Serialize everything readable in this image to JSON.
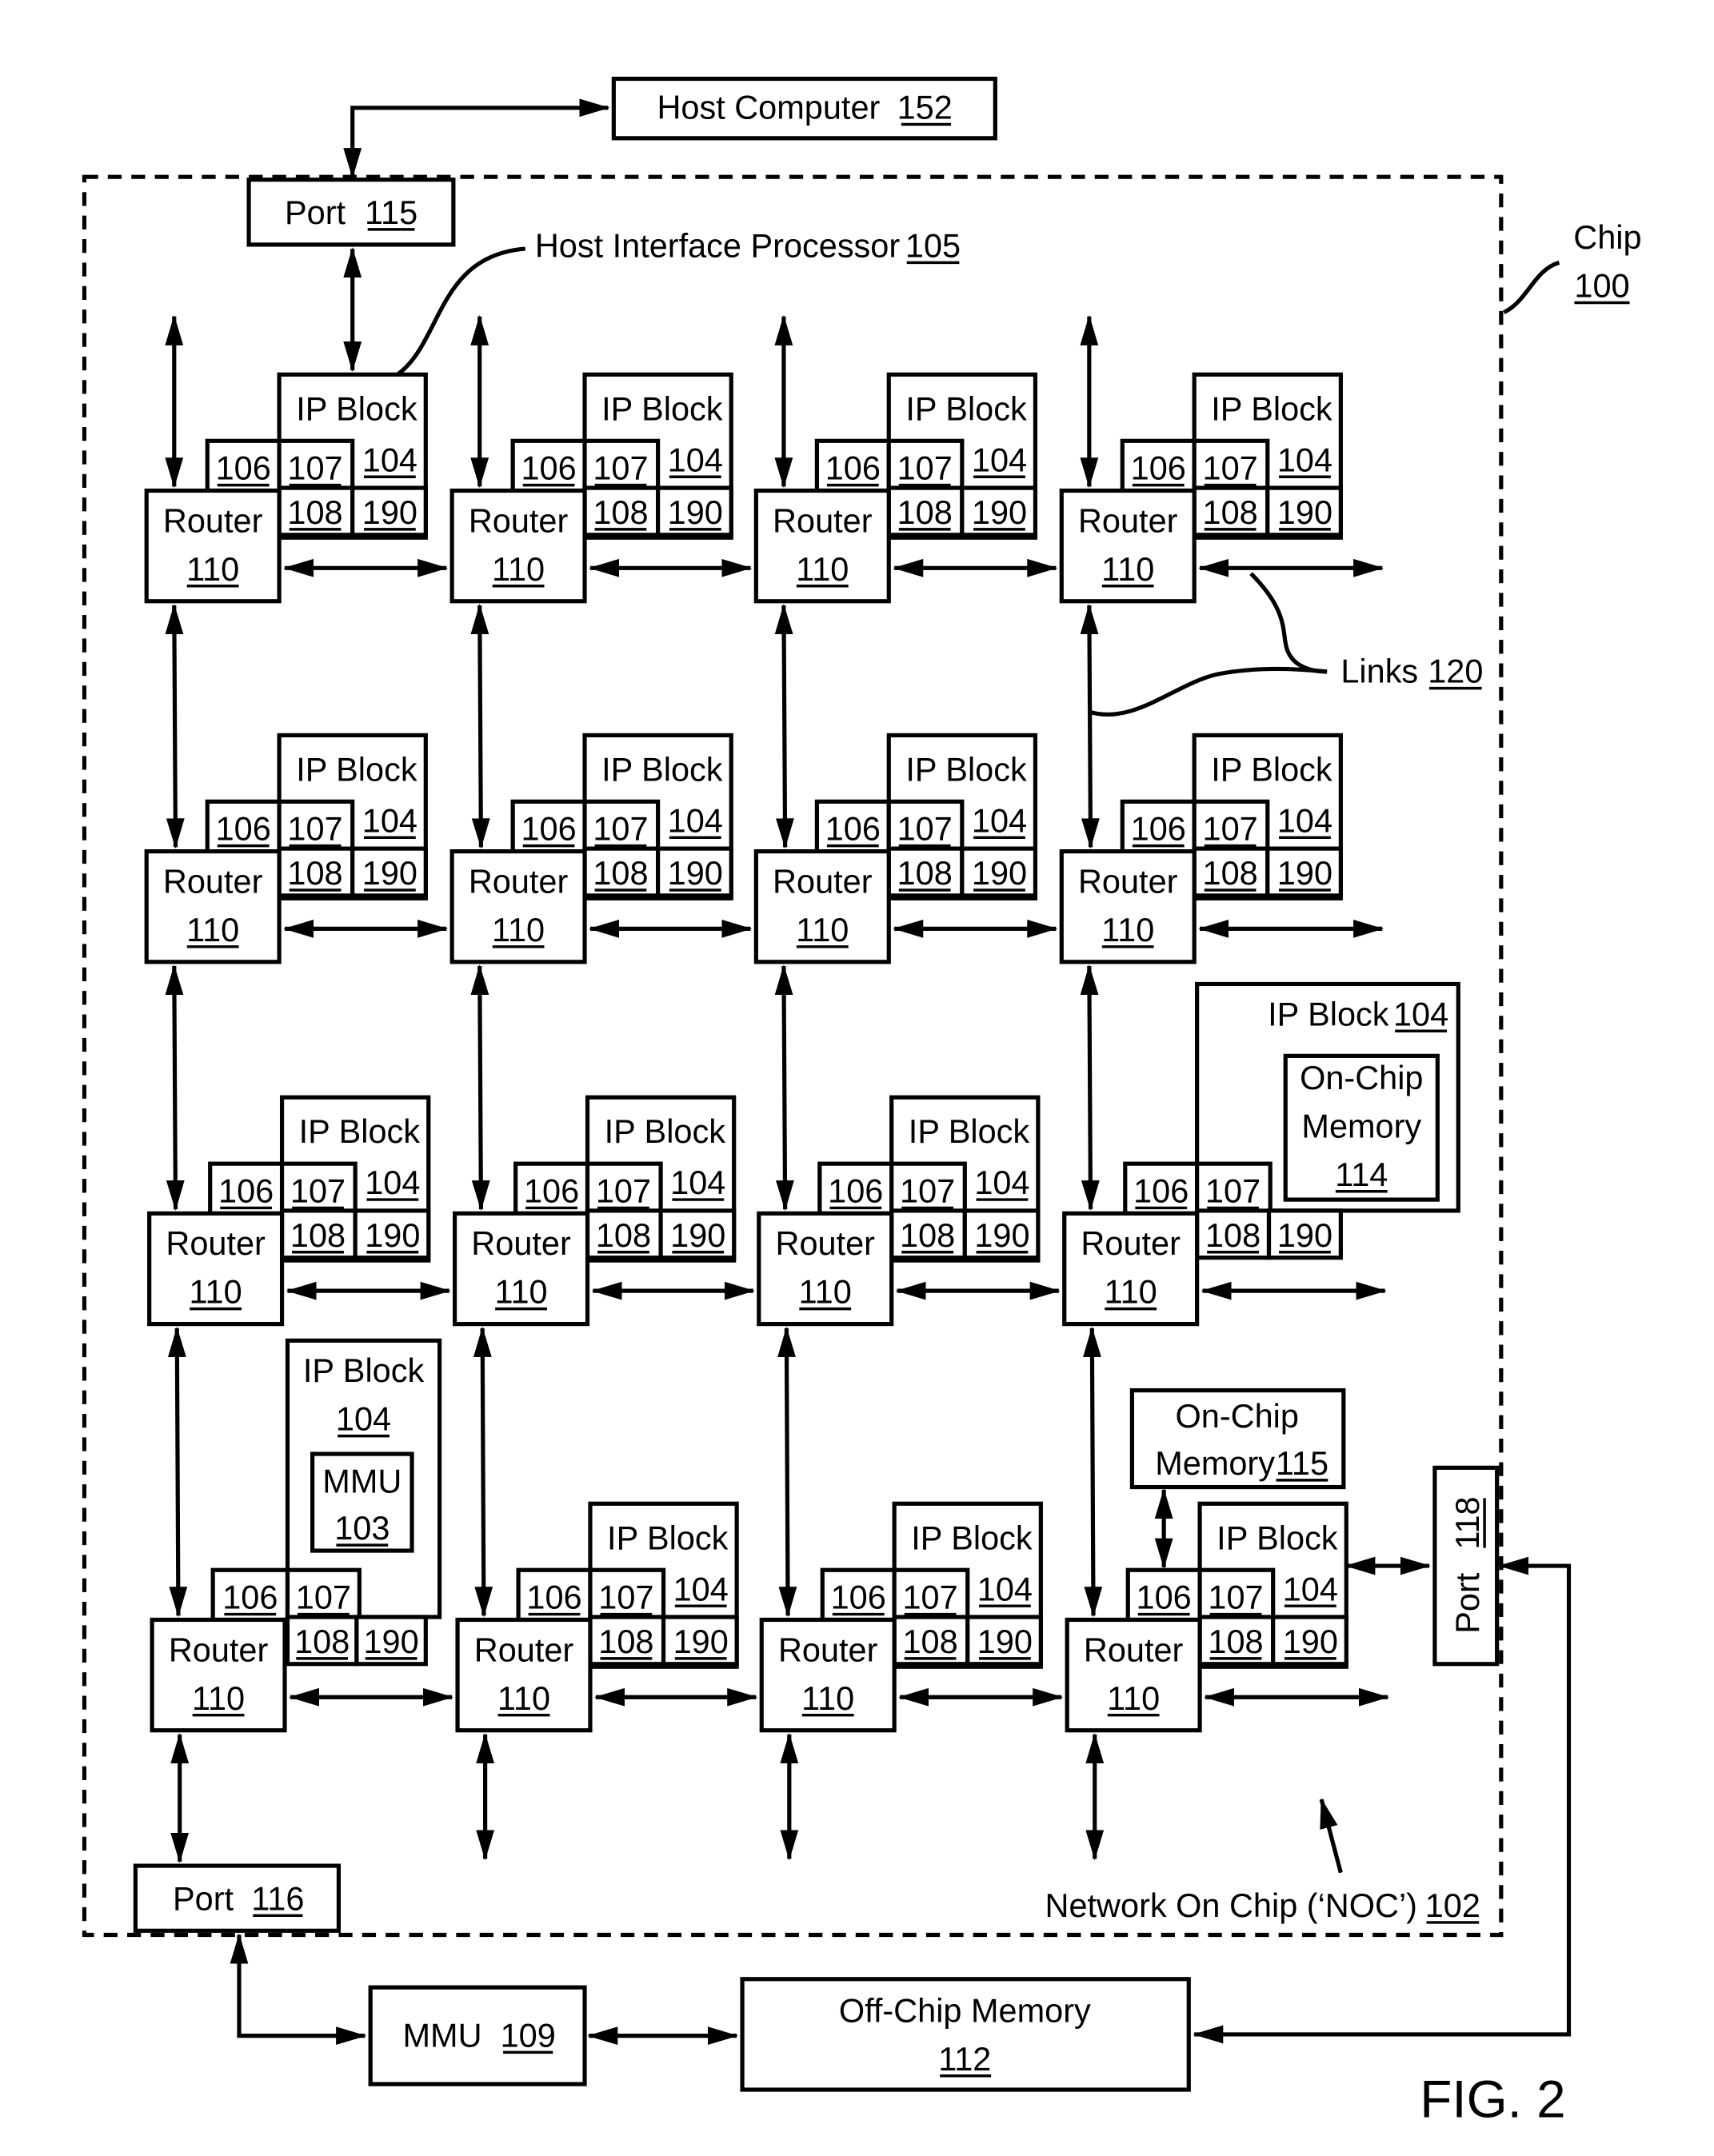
{
  "figure": {
    "title": "FIG. 2",
    "chip": {
      "label": "Chip",
      "ref": "100"
    },
    "noc": {
      "label": "Network On Chip (‘NOC’)",
      "ref": "102"
    },
    "links": {
      "label": "Links",
      "ref": "120"
    },
    "host_interface_processor": {
      "label": "Host Interface Processor",
      "ref": "105"
    },
    "host_computer": {
      "label": "Host Computer",
      "ref": "152"
    },
    "port_115": {
      "label": "Port",
      "ref": "115"
    },
    "port_116": {
      "label": "Port",
      "ref": "116"
    },
    "port_118": {
      "label": "Port",
      "ref": "118"
    },
    "mmu_109": {
      "label": "MMU",
      "ref": "109"
    },
    "off_chip_memory": {
      "label": "Off-Chip Memory",
      "ref": "112"
    },
    "on_chip_memory_114": {
      "line1": "On-Chip",
      "line2": "Memory",
      "ref": "114"
    },
    "on_chip_memory_115": {
      "line1": "On-Chip",
      "line2": "Memory",
      "ref": "115"
    },
    "mmu_103": {
      "label": "MMU",
      "ref": "103"
    },
    "router": {
      "label": "Router",
      "ref": "110"
    },
    "ip_block": {
      "label": "IP Block",
      "ref": "104"
    },
    "sub_refs": {
      "a": "106",
      "b": "107",
      "c": "108",
      "d": "190"
    },
    "grid": {
      "rows": 4,
      "cols": 4,
      "special": {
        "2-3": "ip-block-with-on-chip-memory-114",
        "3-0": "ip-block-with-mmu-103",
        "3-3": "ip-block-with-on-chip-memory-115"
      }
    }
  }
}
